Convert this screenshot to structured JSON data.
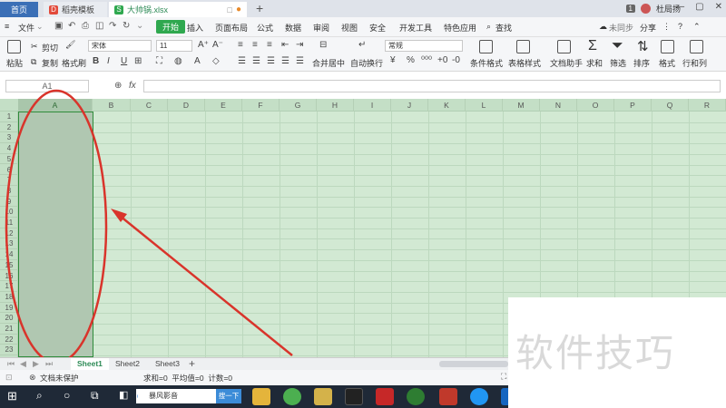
{
  "tabs": {
    "home": "首页",
    "template": "稻壳模板",
    "file": "大帅锅.xlsx"
  },
  "titlebar": {
    "badge": "1",
    "user": "杜局扬"
  },
  "menu": [
    "开始",
    "插入",
    "页面布局",
    "公式",
    "数据",
    "审阅",
    "视图",
    "安全",
    "开发工具",
    "特色应用"
  ],
  "menu_file": "文件",
  "menu_search": "查找",
  "menu_right": {
    "sync": "未同步",
    "share": "分享"
  },
  "ribbon": {
    "paste": "粘贴",
    "cut": "剪切",
    "copy": "复制",
    "format_painter": "格式刷",
    "font": "宋体",
    "size": "11",
    "merge": "合并居中",
    "wrap": "自动换行",
    "number_format": "常规",
    "cond_format": "条件格式",
    "table_style": "表格样式",
    "doc_helper": "文档助手",
    "sum": "求和",
    "filter": "筛选",
    "sort": "排序",
    "format": "格式",
    "rowcol": "行和列"
  },
  "formula": {
    "cell": "A1",
    "fx": "fx"
  },
  "columns": [
    "A",
    "B",
    "C",
    "D",
    "E",
    "F",
    "G",
    "H",
    "I",
    "J",
    "K",
    "L",
    "M",
    "N",
    "O",
    "P",
    "Q",
    "R"
  ],
  "rows": [
    "1",
    "2",
    "3",
    "4",
    "5",
    "6",
    "7",
    "8",
    "9",
    "10",
    "11",
    "12",
    "13",
    "14",
    "15",
    "16",
    "17",
    "18",
    "19",
    "20",
    "21",
    "22",
    "23"
  ],
  "sheets": [
    "Sheet1",
    "Sheet2",
    "Sheet3"
  ],
  "status": {
    "protect": "文档未保护",
    "stats": "求和=0  平均值=0  计数=0"
  },
  "taskbar": {
    "search_text": "暴风影音",
    "search_btn": "搜一下"
  },
  "watermark": "软件技巧",
  "colors": {
    "sheet_bg": "#d2e9d3",
    "selection": "#b0c7b1",
    "annotation": "#d9342b",
    "accent": "#2fa84f"
  }
}
